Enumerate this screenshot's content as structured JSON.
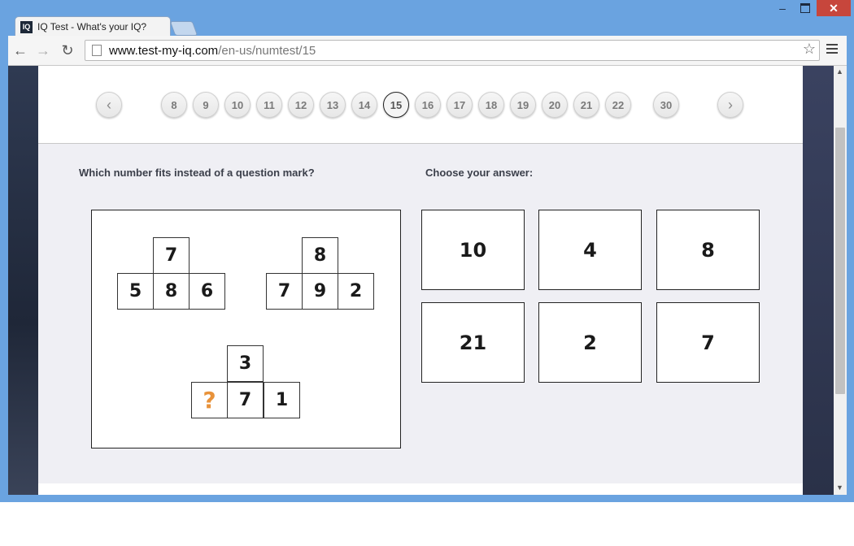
{
  "browser": {
    "tab_title": "IQ Test - What's your IQ?",
    "favicon_text": "IQ",
    "url_host": "www.test-my-iq.com",
    "url_path": "/en-us/numtest/15",
    "icons": [
      "back-arrow-icon",
      "forward-arrow-icon",
      "reload-icon",
      "page-icon",
      "star-icon",
      "menu-icon",
      "minimize-icon",
      "maximize-icon",
      "close-icon"
    ]
  },
  "pager": {
    "prev_label": "‹",
    "next_label": "›",
    "pages": [
      "8",
      "9",
      "10",
      "11",
      "12",
      "13",
      "14",
      "15",
      "16",
      "17",
      "18",
      "19",
      "20",
      "21",
      "22",
      "30"
    ],
    "current": "15"
  },
  "question": {
    "prompt": "Which number fits instead of a question mark?",
    "choose_label": "Choose your answer:",
    "groups": [
      {
        "top": "7",
        "bottom": [
          "5",
          "8",
          "6"
        ]
      },
      {
        "top": "8",
        "bottom": [
          "7",
          "9",
          "2"
        ]
      },
      {
        "top": "3",
        "bottom": [
          "?",
          "7",
          "1"
        ]
      }
    ]
  },
  "answers": [
    "10",
    "4",
    "8",
    "21",
    "2",
    "7"
  ],
  "colors": {
    "accent_question_mark": "#e8923a",
    "content_bg": "#efeff4",
    "window_frame": "#6aa3e0"
  }
}
